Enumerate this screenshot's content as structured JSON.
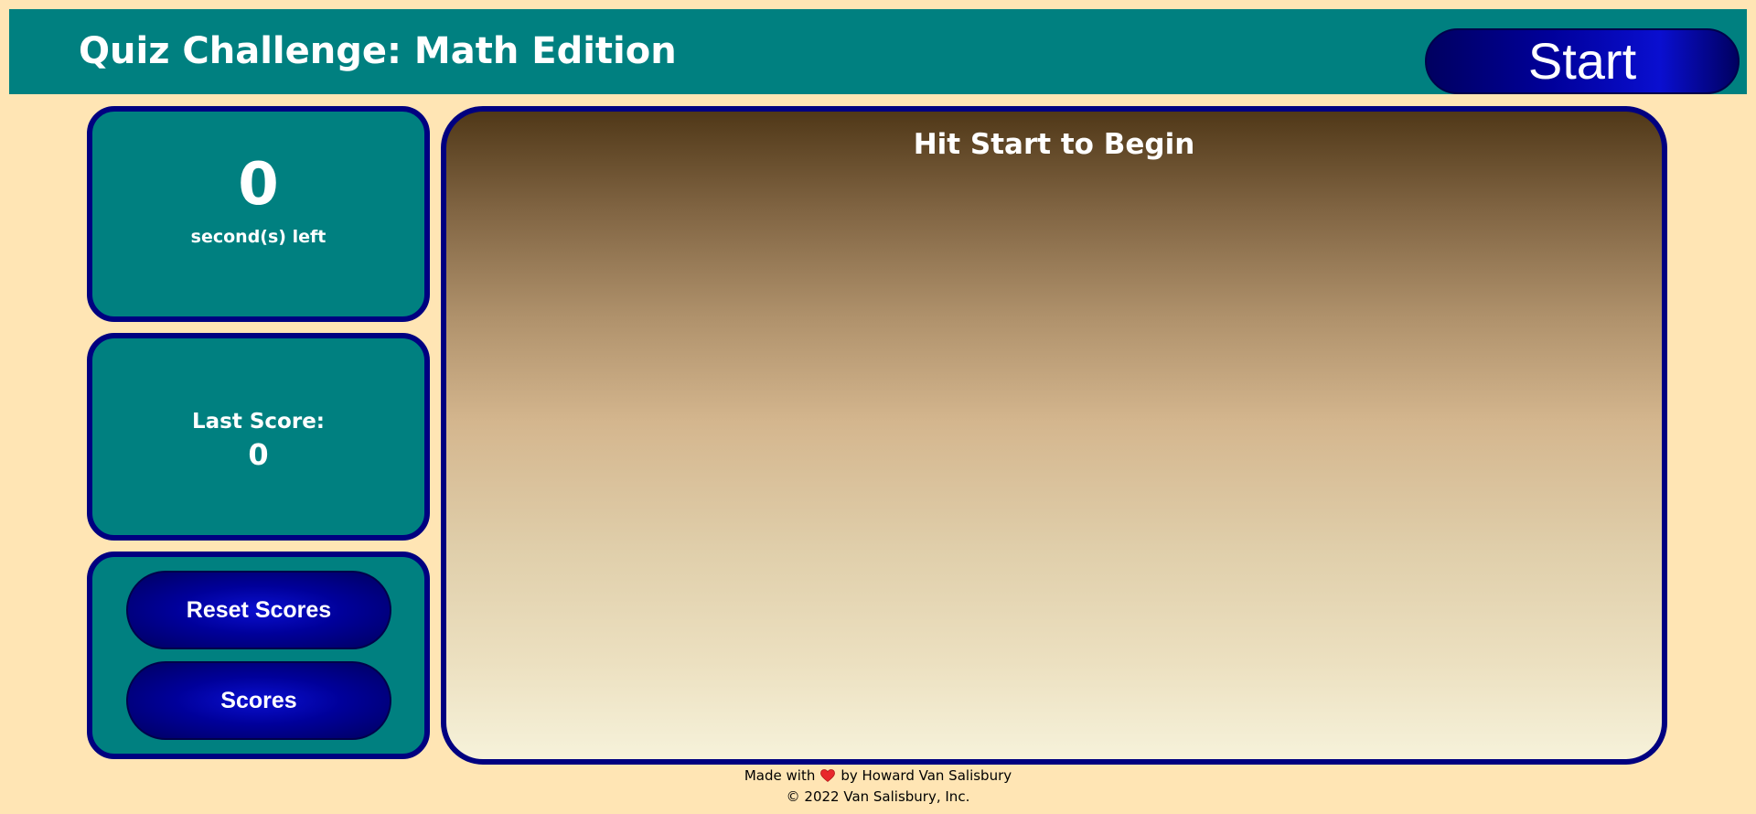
{
  "header": {
    "title": "Quiz Challenge: Math Edition",
    "start_label": "Start"
  },
  "timer": {
    "value": "0",
    "unit_label": "second(s) left"
  },
  "last_score": {
    "label": "Last Score:",
    "value": "0"
  },
  "controls": {
    "reset_label": "Reset Scores",
    "scores_label": "Scores"
  },
  "quiz": {
    "prompt": "Hit Start to Begin"
  },
  "footer": {
    "made_with": "Made with",
    "by": "by Howard Van Salisbury",
    "copyright": "© 2022 Van Salisbury, Inc.",
    "heart_icon": "heart-icon"
  },
  "colors": {
    "background": "#FFE5B4",
    "teal": "#008080",
    "navy_border": "#000080",
    "button_blue": "#00009a",
    "heart": "#e8272b"
  }
}
